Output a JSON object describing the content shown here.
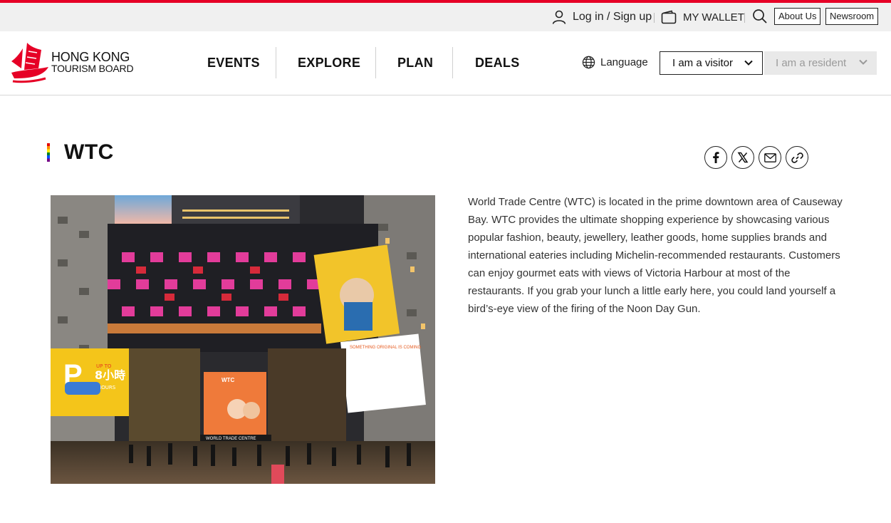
{
  "utility": {
    "login_label": "Log in / Sign up",
    "wallet_label": "MY WALLET",
    "about_label": "About Us",
    "newsroom_label": "Newsroom"
  },
  "logo": {
    "line1": "HONG KONG",
    "line2": "TOURISM BOARD"
  },
  "nav": {
    "items": [
      {
        "label": "EVENTS"
      },
      {
        "label": "EXPLORE"
      },
      {
        "label": "PLAN"
      },
      {
        "label": "DEALS"
      }
    ]
  },
  "header": {
    "language_label": "Language",
    "visitor_label": "I am a visitor",
    "resident_label": "I am a resident"
  },
  "page": {
    "title": "WTC",
    "description": "World Trade Centre (WTC) is located in the prime downtown area of Causeway Bay. WTC provides the ultimate shopping experience by showcasing various popular fashion, beauty, jewellery, leather goods, home supplies brands and international eateries including Michelin-recommended restaurants. Customers can enjoy gourmet eats with views of Victoria Harbour at most of the restaurants. If you grab your lunch a little early here, you could land yourself a bird’s-eye view of the firing of the Noon Day Gun."
  },
  "photo": {
    "billboard_left": "8小時",
    "billboard_left_sub": "UP TO",
    "billboard_left_hours": "HOURS",
    "sign_wtc": "WTC",
    "sign_center": "WORLD TRADE CENTRE",
    "poster_right": "SOMETHING ORIGINAL IS COMING"
  },
  "colors": {
    "brand_red": "#e60026",
    "text_dark": "#111111",
    "utility_bg": "#f0f0f0",
    "resident_bg": "#e9e9e9"
  },
  "icons": {
    "user": "user-icon",
    "wallet": "wallet-icon",
    "search": "search-icon",
    "globe": "globe-icon",
    "chevron": "chevron-down-icon",
    "facebook": "facebook-icon",
    "x": "x-icon",
    "mail": "mail-icon",
    "link": "link-icon"
  }
}
